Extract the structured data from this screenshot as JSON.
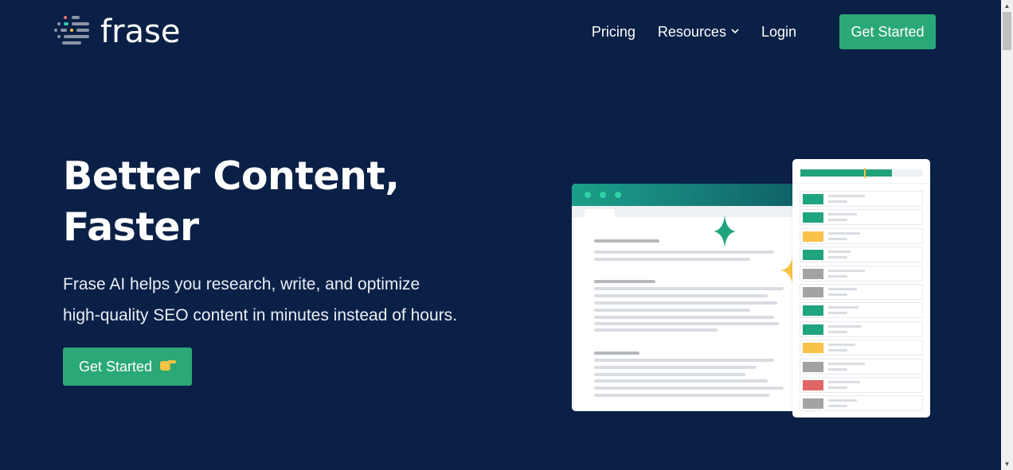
{
  "brand": {
    "name": "frase",
    "logo_colors": [
      "#f86c6b",
      "#2ec8a0",
      "#f6c344",
      "#8b95a7"
    ]
  },
  "nav": {
    "items": [
      {
        "label": "Pricing",
        "icon": null
      },
      {
        "label": "Resources",
        "icon": "chevron-down-icon"
      },
      {
        "label": "Login",
        "icon": null
      }
    ],
    "cta_label": "Get Started"
  },
  "hero": {
    "title_line1": "Better Content,",
    "title_line2": "Faster",
    "subtitle": "Frase AI helps you research, write, and optimize high-quality SEO content in minutes instead of hours.",
    "cta_label": "Get Started",
    "cta_icon": "pointing-hand-icon"
  },
  "illustration": {
    "score_fraction": 0.75,
    "topic_status": [
      "green",
      "green",
      "yellow",
      "green",
      "gray",
      "gray",
      "green",
      "green",
      "yellow",
      "gray",
      "red",
      "gray"
    ]
  },
  "colors": {
    "background": "#0b2046",
    "accent_green": "#2aa876",
    "status_green": "#1fa47f",
    "status_yellow": "#f9c24b",
    "status_gray": "#a3a3a3",
    "status_red": "#e06666"
  }
}
